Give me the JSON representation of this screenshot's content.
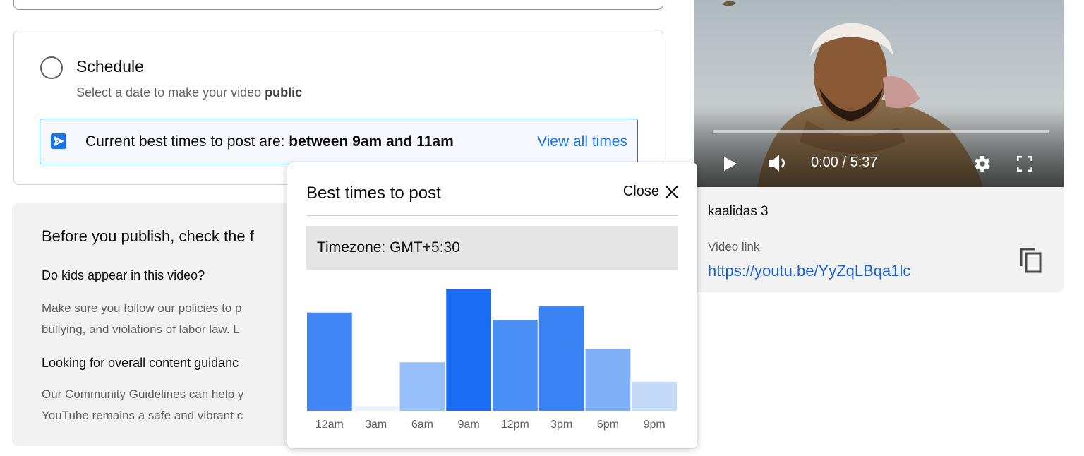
{
  "schedule": {
    "title": "Schedule",
    "subtitle_prefix": "Select a date to make your video ",
    "subtitle_bold": "public",
    "banner_prefix": "Current best times to post are: ",
    "banner_bold": "between 9am and 11am",
    "view_all": "View all times"
  },
  "checklist": {
    "heading": "Before you publish, check the f",
    "kids_question": "Do kids appear in this video?",
    "kids_text_line1": "Make sure you follow our policies to p",
    "kids_text_line2": "bullying, and violations of labor law. L",
    "guidance_question": "Looking for overall content guidanc",
    "guidance_text_line1": "Our Community Guidelines can help y",
    "guidance_text_line2": "YouTube remains a safe and vibrant c"
  },
  "popup": {
    "title": "Best times to post",
    "close_label": "Close",
    "timezone": "Timezone: GMT+5:30"
  },
  "chart_data": {
    "type": "bar",
    "categories": [
      "12am",
      "3am",
      "6am",
      "9am",
      "12pm",
      "3pm",
      "6pm",
      "9pm"
    ],
    "values": [
      81,
      4,
      40,
      100,
      75,
      86,
      51,
      24
    ],
    "colors": [
      "#4285f4",
      "#eaf2fe",
      "#98c1fb",
      "#1a6cf5",
      "#4a8ff6",
      "#3a83f5",
      "#80b0f8",
      "#c4daf9"
    ],
    "ylim": [
      0,
      100
    ],
    "title": "",
    "xlabel": "",
    "ylabel": "",
    "grid": false
  },
  "video": {
    "time": "0:00 / 5:37",
    "title": "kaalidas 3",
    "link_label": "Video link",
    "link": "https://youtu.be/YyZqLBqa1lc"
  },
  "colors": {
    "accent": "#1a73e8",
    "link": "#1a5fd0",
    "panel_bg": "#f2f2f2"
  }
}
